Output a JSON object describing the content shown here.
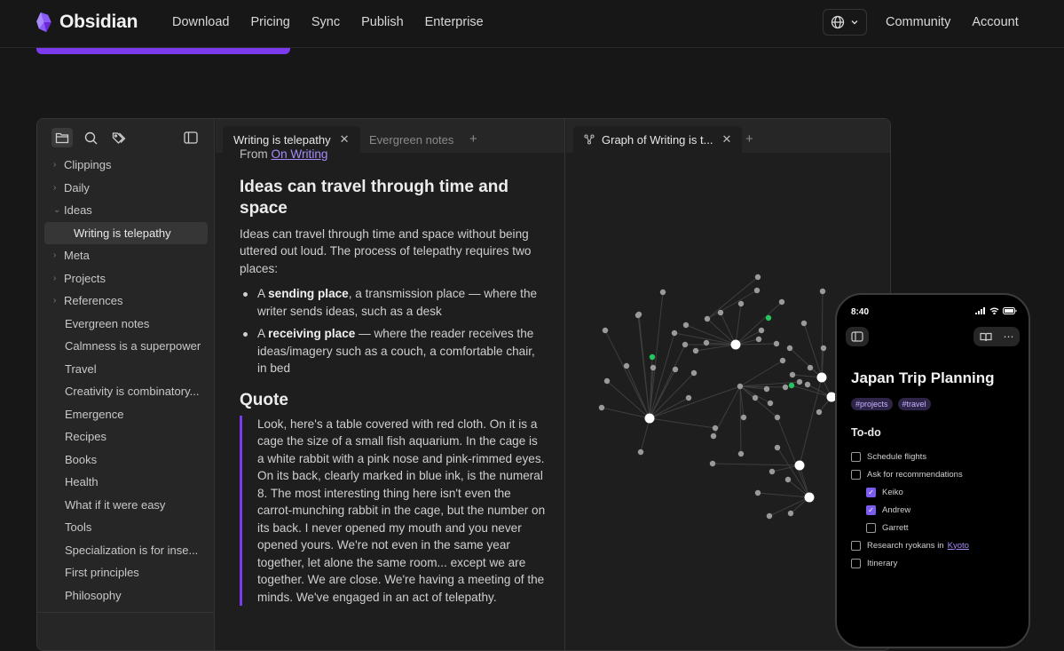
{
  "nav": {
    "brand": "Obsidian",
    "links": [
      "Download",
      "Pricing",
      "Sync",
      "Publish",
      "Enterprise"
    ],
    "community": "Community",
    "account": "Account"
  },
  "sidebar": {
    "items": [
      {
        "label": "Clippings",
        "kind": "folder"
      },
      {
        "label": "Daily",
        "kind": "folder"
      },
      {
        "label": "Ideas",
        "kind": "folder-open"
      },
      {
        "label": "Writing is telepathy",
        "kind": "child-selected"
      },
      {
        "label": "Meta",
        "kind": "folder"
      },
      {
        "label": "Projects",
        "kind": "folder"
      },
      {
        "label": "References",
        "kind": "folder"
      },
      {
        "label": "Evergreen notes",
        "kind": "file"
      },
      {
        "label": "Calmness is a superpower",
        "kind": "file"
      },
      {
        "label": "Travel",
        "kind": "file"
      },
      {
        "label": "Creativity is combinatory...",
        "kind": "file"
      },
      {
        "label": "Emergence",
        "kind": "file"
      },
      {
        "label": "Recipes",
        "kind": "file"
      },
      {
        "label": "Books",
        "kind": "file"
      },
      {
        "label": "Health",
        "kind": "file"
      },
      {
        "label": "What if it were easy",
        "kind": "file"
      },
      {
        "label": "Tools",
        "kind": "file"
      },
      {
        "label": "Specialization is for inse...",
        "kind": "file"
      },
      {
        "label": "First principles",
        "kind": "file"
      },
      {
        "label": "Philosophy",
        "kind": "file"
      }
    ]
  },
  "editor": {
    "tabs": {
      "active": "Writing is telepathy",
      "inactive": "Evergreen notes"
    },
    "from_prefix": "From ",
    "from_link": "On Writing",
    "heading1": "Ideas can travel through time and space",
    "para1": "Ideas can travel through time and space without being uttered out loud. The process of telepathy requires two places:",
    "bullet1": {
      "pre": "A ",
      "bold": "sending place",
      "post": ", a transmission place — where the writer sends ideas, such as a desk"
    },
    "bullet2": {
      "pre": "A ",
      "bold": "receiving place",
      "post": " — where the reader receives the ideas/imagery such as a couch, a comfortable chair, in bed"
    },
    "heading2": "Quote",
    "quote": "Look, here's a table covered with red cloth. On it is a cage the size of a small fish aquarium. In the cage is a white rabbit with a pink nose and pink-rimmed eyes. On its back, clearly marked in blue ink, is the numeral 8. The most interesting thing here isn't even the carrot-munching rabbit in the cage, but the number on its back. I never opened my mouth and you never opened yours. We're not even in the same year together, let alone the same room... except we are together. We are close. We're having a meeting of the minds. We've engaged in an act of telepathy."
  },
  "graph": {
    "tab": "Graph of Writing is t...",
    "colors": {
      "node": "#9a9a9a",
      "hub": "#ffffff",
      "tag": "#22c55e",
      "edge": "#3e3e3e"
    }
  },
  "phone": {
    "time": "8:40",
    "title": "Japan Trip Planning",
    "tags": [
      "#projects",
      "#travel"
    ],
    "todo_heading": "To-do",
    "tasks": [
      {
        "label": "Schedule flights",
        "checked": false,
        "sub": false
      },
      {
        "label": "Ask for recommendations",
        "checked": false,
        "sub": false
      },
      {
        "label": "Keiko",
        "checked": true,
        "sub": true
      },
      {
        "label": "Andrew",
        "checked": true,
        "sub": true
      },
      {
        "label": "Garrett",
        "checked": false,
        "sub": true
      },
      {
        "label": "Research ryokans in",
        "link": "Kyoto",
        "checked": false,
        "sub": false
      },
      {
        "label": "Itinerary",
        "checked": false,
        "sub": false
      }
    ]
  },
  "accent": "#7c3aed"
}
